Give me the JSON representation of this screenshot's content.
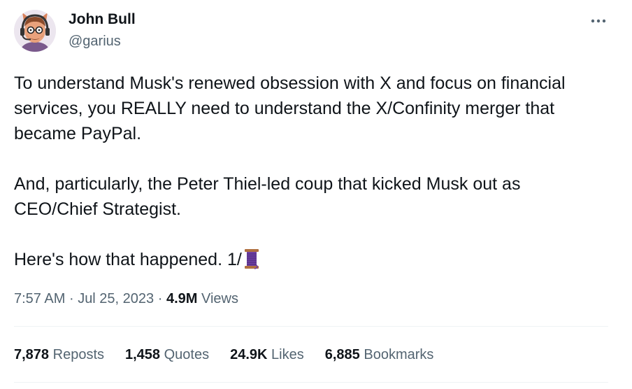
{
  "author": {
    "display_name": "John Bull",
    "handle": "@garius",
    "avatar_icon": "cartoon-avatar-with-headphones-and-glasses"
  },
  "more_icon": "more-horizontal-icon",
  "tweet": {
    "paragraphs": [
      "To understand Musk's renewed obsession with X and focus on financial\nservices, you REALLY need to understand the X/Confinity merger that\nbecame PayPal.",
      "And, particularly, the Peter Thiel-led coup that kicked Musk out as\nCEO/Chief Strategist.",
      "Here's how that happened.  1/"
    ],
    "thread_emoji": "spool-of-thread-emoji"
  },
  "meta": {
    "time": "7:57 AM",
    "separator": "·",
    "date": "Jul 25, 2023",
    "views_count": "4.9M",
    "views_label": "Views"
  },
  "stats": [
    {
      "value": "7,878",
      "label": "Reposts"
    },
    {
      "value": "1,458",
      "label": "Quotes"
    },
    {
      "value": "24.9K",
      "label": "Likes"
    },
    {
      "value": "6,885",
      "label": "Bookmarks"
    }
  ],
  "colors": {
    "text_primary": "#0f1419",
    "text_secondary": "#536471",
    "divider": "#eff3f4"
  }
}
